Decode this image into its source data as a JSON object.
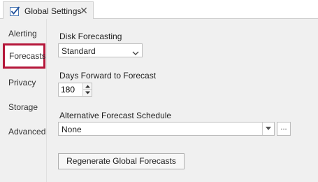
{
  "tab": {
    "title": "Global Settings",
    "icon": "settings-checklist-icon",
    "close_glyph": "✕"
  },
  "sidebar": {
    "items": [
      {
        "label": "Alerting",
        "selected": false
      },
      {
        "label": "Forecasts",
        "selected": true
      },
      {
        "label": "Privacy",
        "selected": false
      },
      {
        "label": "Storage",
        "selected": false
      },
      {
        "label": "Advanced",
        "selected": false
      }
    ],
    "selected_outline_color": "#b5173a"
  },
  "forecasts": {
    "disk_forecasting": {
      "label": "Disk Forecasting",
      "value": "Standard"
    },
    "days_forward": {
      "label": "Days Forward to Forecast",
      "value": "180"
    },
    "alternative_schedule": {
      "label": "Alternative Forecast Schedule",
      "value": "None",
      "browse_label": "..."
    },
    "regenerate_button": "Regenerate Global Forecasts"
  }
}
